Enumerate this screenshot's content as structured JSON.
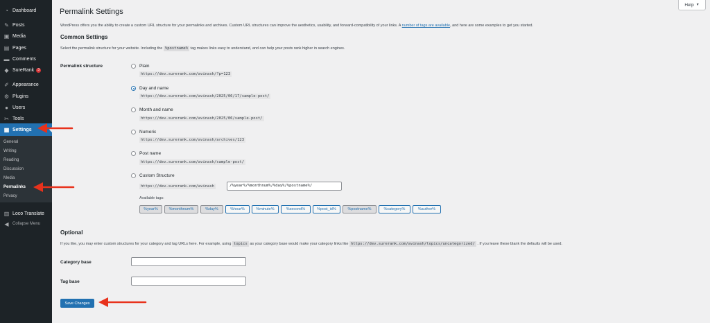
{
  "sidebar": {
    "items": [
      {
        "label": "Dashboard",
        "icon": "dashboard-icon",
        "glyph": "◔"
      },
      {
        "label": "Posts",
        "icon": "pin-icon",
        "glyph": "✎"
      },
      {
        "label": "Media",
        "icon": "media-icon",
        "glyph": "▣"
      },
      {
        "label": "Pages",
        "icon": "pages-icon",
        "glyph": "▤"
      },
      {
        "label": "Comments",
        "icon": "comments-icon",
        "glyph": "▬"
      },
      {
        "label": "SureRank",
        "icon": "surerank-icon",
        "glyph": "◆",
        "badge": "3"
      },
      {
        "label": "Appearance",
        "icon": "brush-icon",
        "glyph": "✐"
      },
      {
        "label": "Plugins",
        "icon": "plugin-icon",
        "glyph": "⚙"
      },
      {
        "label": "Users",
        "icon": "users-icon",
        "glyph": "●"
      },
      {
        "label": "Tools",
        "icon": "wrench-icon",
        "glyph": "✂"
      },
      {
        "label": "Settings",
        "icon": "settings-icon",
        "glyph": "▦"
      },
      {
        "label": "Loco Translate",
        "icon": "translate-icon",
        "glyph": "▥"
      },
      {
        "label": "Collapse Menu",
        "icon": "collapse-icon",
        "glyph": "◀"
      }
    ],
    "submenu": [
      "General",
      "Writing",
      "Reading",
      "Discussion",
      "Media",
      "Permalinks",
      "Privacy"
    ]
  },
  "help_label": "Help",
  "page_title": "Permalink Settings",
  "intro": {
    "before_link": "WordPress offers you the ability to create a custom URL structure for your permalinks and archives. Custom URL structures can improve the aesthetics, usability, and forward-compatibility of your links. A ",
    "link": "number of tags are available",
    "after_link": ", and here are some examples to get you started."
  },
  "common": {
    "heading": "Common Settings",
    "desc_before": "Select the permalink structure for your website. Including the",
    "desc_code": "%postname%",
    "desc_after": "tag makes links easy to understand, and can help your posts rank higher in search engines.",
    "field_label": "Permalink structure",
    "options": [
      {
        "label": "Plain",
        "url": "https://dev.surerank.com/avinash/?p=123",
        "checked": false
      },
      {
        "label": "Day and name",
        "url": "https://dev.surerank.com/avinash/2025/06/17/sample-post/",
        "checked": true
      },
      {
        "label": "Month and name",
        "url": "https://dev.surerank.com/avinash/2025/06/sample-post/",
        "checked": false
      },
      {
        "label": "Numeric",
        "url": "https://dev.surerank.com/avinash/archives/123",
        "checked": false
      },
      {
        "label": "Post name",
        "url": "https://dev.surerank.com/avinash/sample-post/",
        "checked": false
      }
    ],
    "custom": {
      "label": "Custom Structure",
      "prefix": "https://dev.surerank.com/avinash",
      "value": "/%year%/%monthnum%/%day%/%postname%/",
      "available_label": "Available tags:",
      "tags": [
        {
          "label": "%year%",
          "pressed": true
        },
        {
          "label": "%monthnum%",
          "pressed": true
        },
        {
          "label": "%day%",
          "pressed": true
        },
        {
          "label": "%hour%",
          "pressed": false
        },
        {
          "label": "%minute%",
          "pressed": false
        },
        {
          "label": "%second%",
          "pressed": false
        },
        {
          "label": "%post_id%",
          "pressed": false
        },
        {
          "label": "%postname%",
          "pressed": true
        },
        {
          "label": "%category%",
          "pressed": false
        },
        {
          "label": "%author%",
          "pressed": false
        }
      ]
    }
  },
  "optional": {
    "heading": "Optional",
    "desc_before": "If you like, you may enter custom structures for your category and tag URLs here. For example, using",
    "desc_code1": "topics",
    "desc_mid": "as your category base would make your category links like",
    "desc_code2": "https://dev.surerank.com/avinash/topics/uncategorized/",
    "desc_after": ". If you leave these blank the defaults will be used.",
    "category_label": "Category base",
    "category_value": "",
    "tag_label": "Tag base",
    "tag_value": ""
  },
  "save_label": "Save Changes",
  "colors": {
    "sidebar_bg": "#1d2327",
    "accent": "#2271b1",
    "annotation_arrow": "#e8321c",
    "badge": "#d63638"
  }
}
